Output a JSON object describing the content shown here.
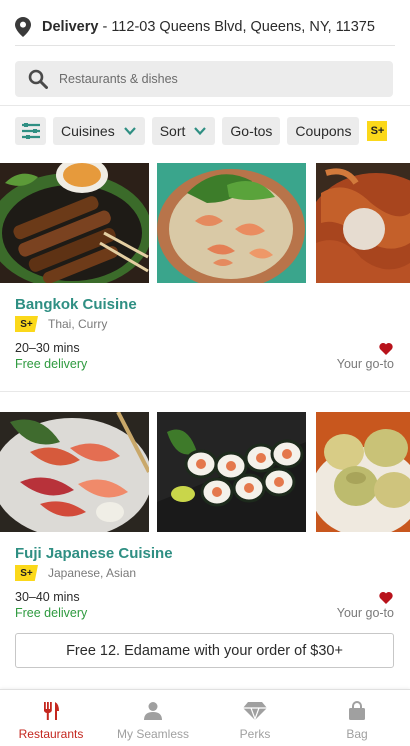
{
  "header": {
    "delivery_label": "Delivery",
    "address": " - 112-03 Queens Blvd, Queens, NY, 11375",
    "search_placeholder": "Restaurants & dishes"
  },
  "filters": {
    "chips": [
      "Cuisines",
      "Sort",
      "Go-tos",
      "Coupons"
    ],
    "plus_badge": "S+"
  },
  "restaurants": [
    {
      "name": "Bangkok Cuisine",
      "badge": "S+",
      "cuisines": "Thai, Curry",
      "time": "20–30 mins",
      "delivery_fee": "Free delivery",
      "tag": "Your go-to",
      "favorited": true
    },
    {
      "name": "Fuji Japanese Cuisine",
      "badge": "S+",
      "cuisines": "Japanese, Asian",
      "time": "30–40 mins",
      "delivery_fee": "Free delivery",
      "tag": "Your go-to",
      "favorited": true,
      "promo": "Free 12. Edamame with your order of $30+"
    }
  ],
  "tabs": [
    {
      "label": "Restaurants",
      "icon": "fork-knife-icon",
      "active": true
    },
    {
      "label": "My Seamless",
      "icon": "person-icon",
      "active": false
    },
    {
      "label": "Perks",
      "icon": "gem-icon",
      "active": false
    },
    {
      "label": "Bag",
      "icon": "bag-icon",
      "active": false
    }
  ],
  "colors": {
    "brand_red": "#c4271f",
    "restaurant_name": "#2f8f83",
    "free_delivery": "#2e9a3f",
    "plus_badge": "#fbd81a",
    "filter_chip_bg": "#ececec"
  }
}
